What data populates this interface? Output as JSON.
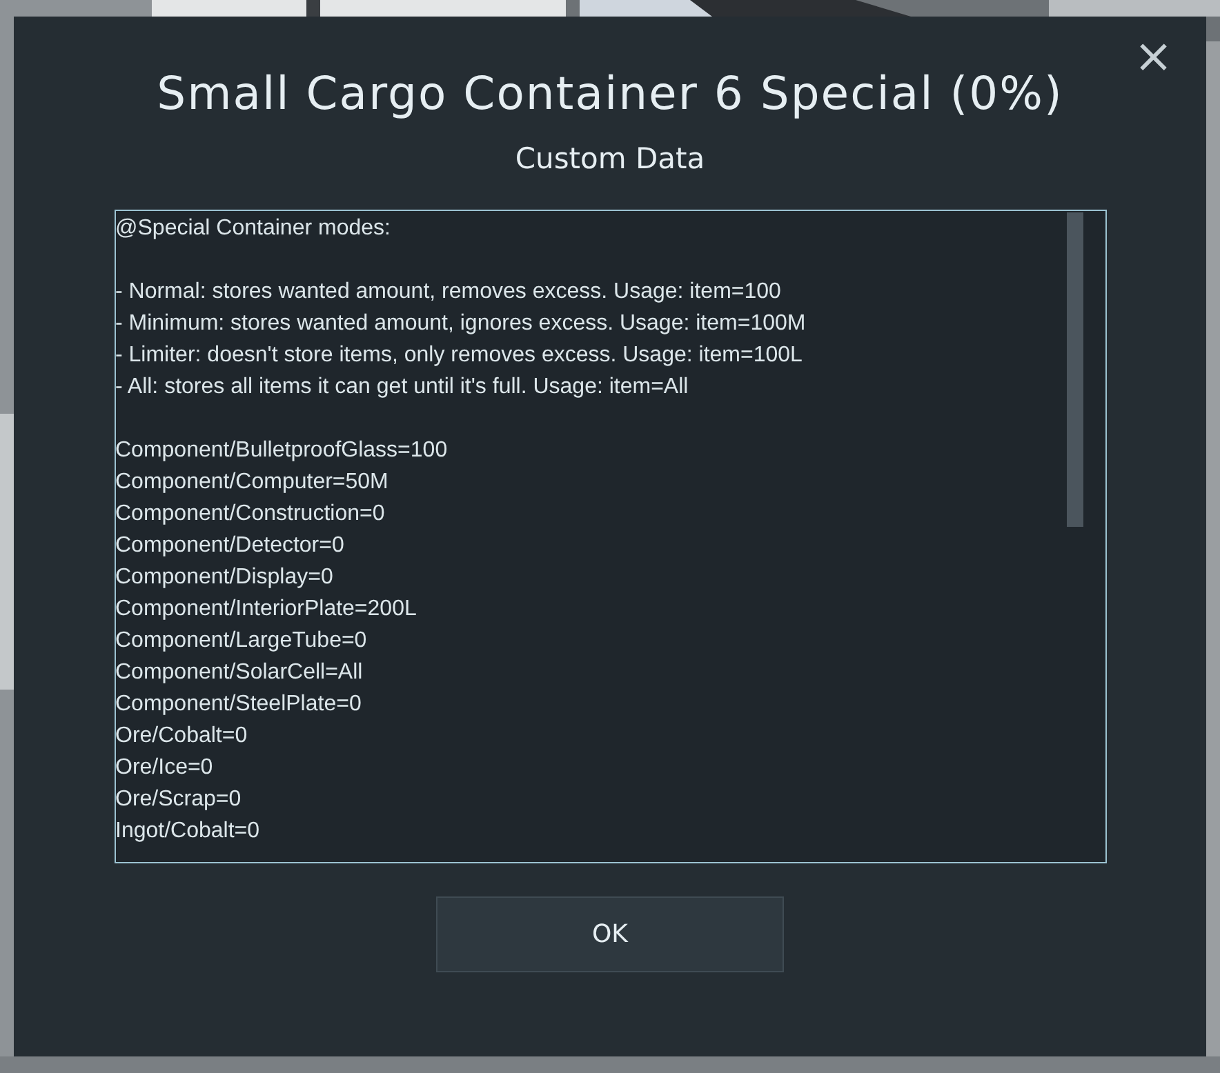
{
  "dialog": {
    "title": "Small Cargo Container 6 Special (0%)",
    "subtitle": "Custom Data",
    "close": "×",
    "custom_data": {
      "blocks": [
        [
          "@Special Container modes:"
        ],
        [
          "- Normal: stores wanted amount, removes excess. Usage: item=100",
          "- Minimum: stores wanted amount, ignores excess. Usage: item=100M",
          "- Limiter: doesn't store items, only removes excess. Usage: item=100L",
          "- All: stores all items it can get until it's full. Usage: item=All"
        ],
        [
          "Component/BulletproofGlass=100",
          "Component/Computer=50M",
          "Component/Construction=0",
          "Component/Detector=0",
          "Component/Display=0",
          "Component/InteriorPlate=200L",
          "Component/LargeTube=0",
          "Component/SolarCell=All",
          "Component/SteelPlate=0",
          "Ore/Cobalt=0",
          "Ore/Ice=0",
          "Ore/Scrap=0",
          "Ingot/Cobalt=0"
        ]
      ]
    },
    "buttons": [
      "OK"
    ]
  }
}
